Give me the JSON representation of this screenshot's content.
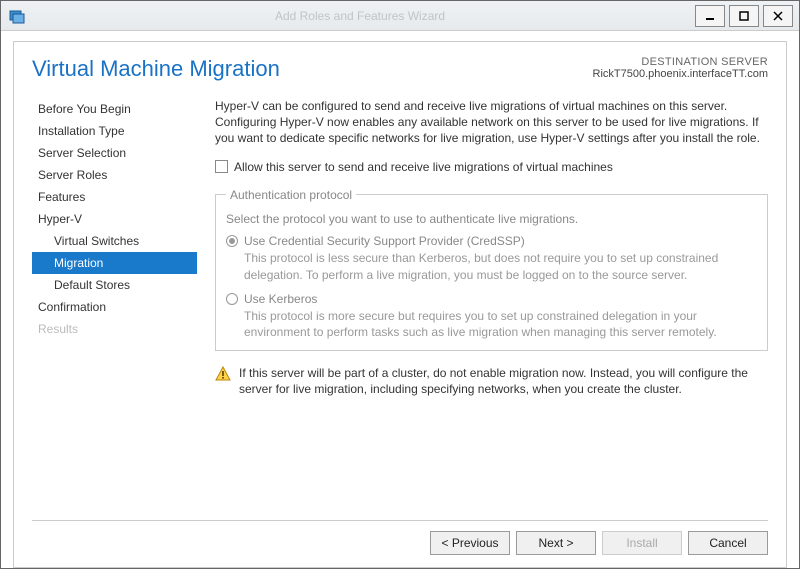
{
  "window": {
    "title": "Add Roles and Features Wizard"
  },
  "header": {
    "title": "Virtual Machine Migration",
    "dest_label": "DESTINATION SERVER",
    "dest_name": "RickT7500.phoenix.interfaceTT.com"
  },
  "sidebar": {
    "items": [
      {
        "label": "Before You Begin",
        "sub": false
      },
      {
        "label": "Installation Type",
        "sub": false
      },
      {
        "label": "Server Selection",
        "sub": false
      },
      {
        "label": "Server Roles",
        "sub": false
      },
      {
        "label": "Features",
        "sub": false
      },
      {
        "label": "Hyper-V",
        "sub": false
      },
      {
        "label": "Virtual Switches",
        "sub": true
      },
      {
        "label": "Migration",
        "sub": true,
        "selected": true
      },
      {
        "label": "Default Stores",
        "sub": true
      },
      {
        "label": "Confirmation",
        "sub": false
      },
      {
        "label": "Results",
        "sub": false,
        "disabled": true
      }
    ]
  },
  "main": {
    "description": "Hyper-V can be configured to send and receive live migrations of virtual machines on this server. Configuring Hyper-V now enables any available network on this server to be used for live migrations. If you want to dedicate specific networks for live migration, use Hyper-V settings after you install the role.",
    "checkbox_label": "Allow this server to send and receive live migrations of virtual machines",
    "auth": {
      "legend": "Authentication protocol",
      "intro": "Select the protocol you want to use to authenticate live migrations.",
      "options": [
        {
          "title": "Use Credential Security Support Provider (CredSSP)",
          "sub": "This protocol is less secure than Kerberos, but does not require you to set up constrained delegation. To perform a live migration, you must be logged on to the source server.",
          "checked": true
        },
        {
          "title": "Use Kerberos",
          "sub": "This protocol is more secure but requires you to set up constrained delegation in your environment to perform tasks such as live migration when managing this server remotely.",
          "checked": false
        }
      ]
    },
    "warning": "If this server will be part of a cluster, do not enable migration now. Instead, you will configure the server for live migration, including specifying networks, when you create the cluster."
  },
  "footer": {
    "previous": "< Previous",
    "next": "Next >",
    "install": "Install",
    "cancel": "Cancel"
  }
}
